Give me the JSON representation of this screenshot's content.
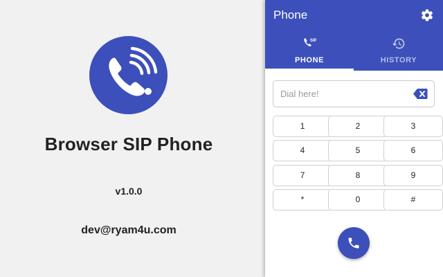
{
  "promo": {
    "logo_icon": "phone-waves-icon",
    "title": "Browser SIP Phone",
    "version": "v1.0.0",
    "email": "dev@ryam4u.com"
  },
  "panel": {
    "title": "Phone",
    "settings_icon": "gear-icon",
    "tabs": [
      {
        "label": "PHONE",
        "icon": "sip-phone-icon",
        "active": true
      },
      {
        "label": "HISTORY",
        "icon": "history-icon",
        "active": false
      }
    ],
    "dial": {
      "placeholder": "Dial here!",
      "value": "",
      "clear_icon": "backspace-icon"
    },
    "keypad": {
      "keys": [
        "1",
        "2",
        "3",
        "4",
        "5",
        "6",
        "7",
        "8",
        "9",
        "*",
        "0",
        "#"
      ]
    },
    "call_icon": "phone-icon"
  },
  "colors": {
    "primary": "#3c4fba",
    "background": "#f1f1f1",
    "panel": "#ffffff",
    "text": "#222222"
  }
}
